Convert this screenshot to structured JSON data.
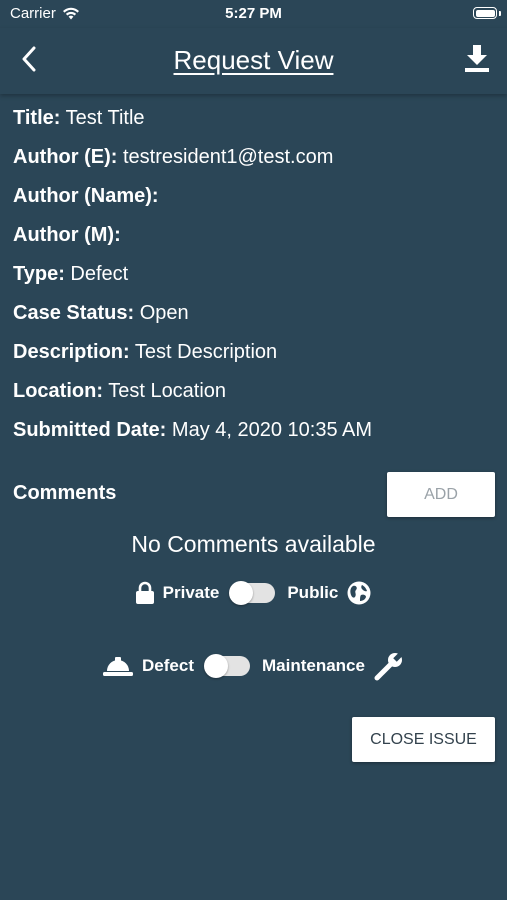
{
  "status_bar": {
    "carrier": "Carrier",
    "time": "5:27 PM"
  },
  "nav": {
    "title": "Request View",
    "back_icon": "chevron-left-icon",
    "download_icon": "download-icon"
  },
  "details": [
    {
      "label": "Title:",
      "value": "Test Title"
    },
    {
      "label": "Author (E):",
      "value": "testresident1@test.com"
    },
    {
      "label": "Author (Name):",
      "value": ""
    },
    {
      "label": "Author (M):",
      "value": ""
    },
    {
      "label": "Type:",
      "value": "Defect"
    },
    {
      "label": "Case Status:",
      "value": "Open"
    },
    {
      "label": "Description:",
      "value": "Test Description"
    },
    {
      "label": "Location:",
      "value": "Test Location"
    },
    {
      "label": "Submitted Date:",
      "value": "May 4, 2020 10:35 AM"
    }
  ],
  "comments": {
    "header": "Comments",
    "add_label": "ADD",
    "empty_text": "No Comments available"
  },
  "privacy_toggle": {
    "left_label": "Private",
    "right_label": "Public",
    "left_icon": "lock-icon",
    "right_icon": "globe-icon"
  },
  "issue_type_toggle": {
    "left_label": "Defect",
    "right_label": "Maintenance",
    "left_icon": "hard-hat-icon",
    "right_icon": "wrench-icon"
  },
  "close_issue_label": "CLOSE ISSUE",
  "colors": {
    "background": "#2b4657",
    "text": "#ffffff",
    "button_bg": "#ffffff"
  }
}
